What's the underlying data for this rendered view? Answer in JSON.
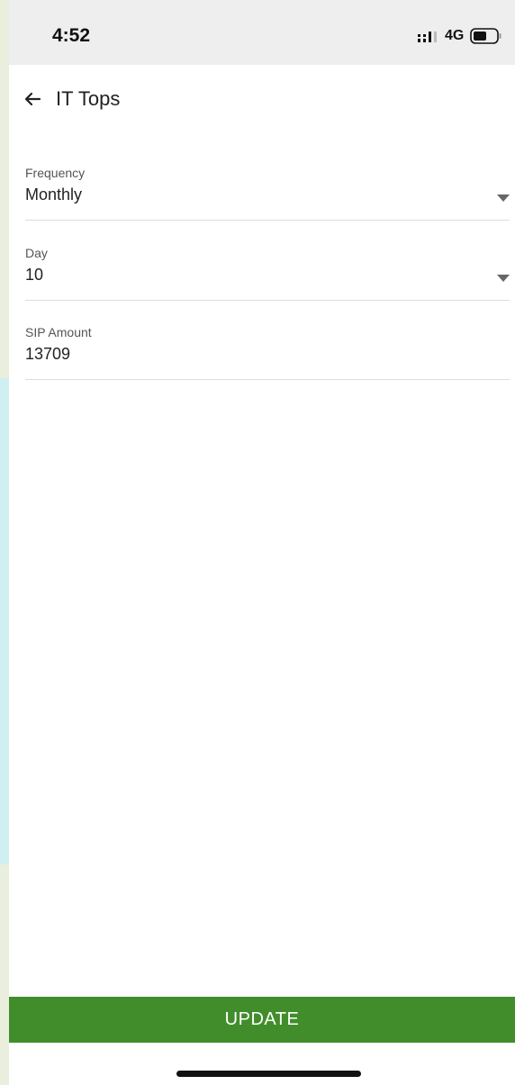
{
  "status_bar": {
    "time": "4:52",
    "network": "4G",
    "signal_icon": "signal-icon",
    "battery_icon": "battery-icon"
  },
  "header": {
    "title": "IT Tops",
    "back_icon": "arrow-left-icon"
  },
  "form": {
    "frequency": {
      "label": "Frequency",
      "value": "Monthly"
    },
    "day": {
      "label": "Day",
      "value": "10"
    },
    "sip_amount": {
      "label": "SIP Amount",
      "value": "13709"
    }
  },
  "actions": {
    "update_label": "UPDATE"
  },
  "colors": {
    "accent": "#418d2b",
    "status_bar_bg": "#eeeeee",
    "background": "#ffffff"
  }
}
